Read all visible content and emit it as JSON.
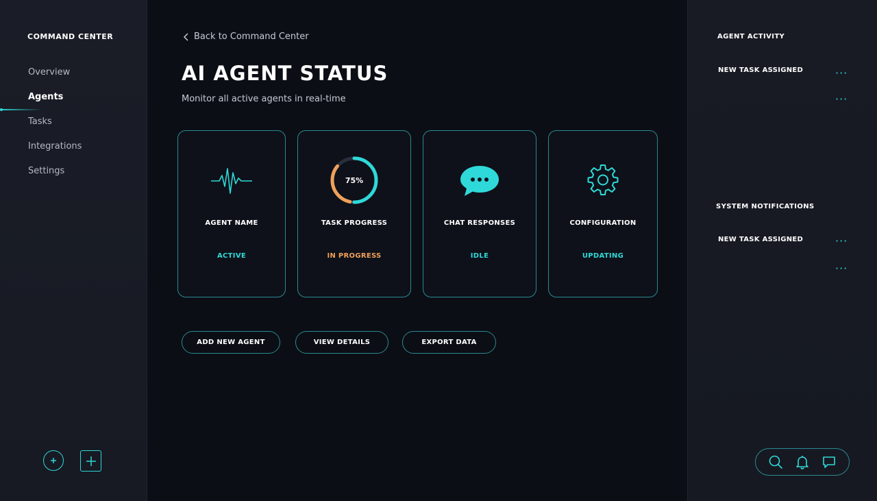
{
  "sidebar": {
    "brand": "COMMAND CENTER",
    "items": [
      {
        "label": "Overview"
      },
      {
        "label": "Agents"
      },
      {
        "label": "Tasks"
      },
      {
        "label": "Integrations"
      },
      {
        "label": "Settings"
      }
    ],
    "active_item": "Agents",
    "bottom_icons": [
      "refresh-add-icon",
      "plus-square-icon"
    ]
  },
  "main": {
    "back_link": "Back to Command Center",
    "title": "AI AGENT STATUS",
    "subtitle": "Monitor all active agents in real-time",
    "cards": [
      {
        "title": "AGENT NAME",
        "status": "ACTIVE",
        "status_color": "#2fd9d9",
        "icon": "pulse-icon"
      },
      {
        "title": "TASK PROGRESS",
        "status": "IN PROGRESS",
        "status_color": "#f0a05a",
        "icon": "progress-ring",
        "progress_label": "75%",
        "progress_value": 0.75
      },
      {
        "title": "CHAT RESPONSES",
        "status": "IDLE",
        "status_color": "#2fd9d9",
        "icon": "chat-bubble-icon"
      },
      {
        "title": "CONFIGURATION",
        "status": "UPDATING",
        "status_color": "#2fd9d9",
        "icon": "gear-icon"
      }
    ],
    "actions": {
      "add": "ADD NEW AGENT",
      "view": "VIEW DETAILS",
      "export": "EXPORT DATA"
    }
  },
  "right_panel": {
    "activity_title": "AGENT ACTIVITY",
    "activity_items": [
      {
        "label": "NEW TASK ASSIGNED"
      },
      {
        "label": ""
      }
    ],
    "notifications_title": "SYSTEM NOTIFICATIONS",
    "notification_items": [
      {
        "label": "NEW TASK ASSIGNED"
      },
      {
        "label": ""
      }
    ],
    "more_glyph": "···",
    "toolbar_icons": [
      "search-icon",
      "bell-icon",
      "chat-icon"
    ]
  },
  "colors": {
    "accent": "#2fd9d9",
    "warning": "#f0a05a",
    "background": "#0c0e15",
    "border": "#2a8a93"
  }
}
